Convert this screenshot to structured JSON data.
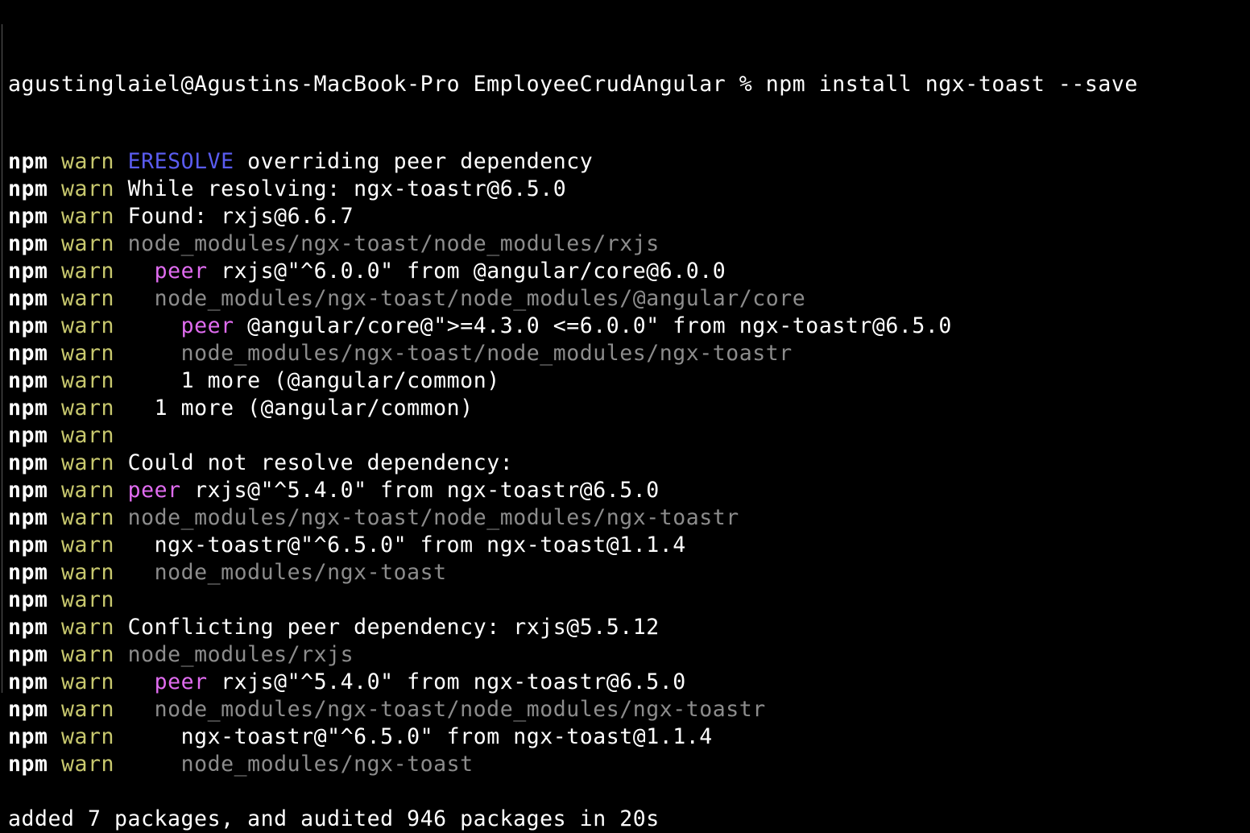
{
  "colors": {
    "background": "#000000",
    "npm": "#ffffff",
    "warn": "#c8c86e",
    "text": "#ffffff",
    "path": "#8c8c8c",
    "peer": "#e06cf0",
    "eresolve": "#5a5cf0"
  },
  "prompt": "agustinglaiel@Agustins-MacBook-Pro EmployeeCrudAngular % npm install ngx-toast --save",
  "npm_label": "npm",
  "warn_label": "warn",
  "lines": [
    {
      "indent": "",
      "tag": "ERESOLVE",
      "tag_style": "eresolve",
      "text": " overriding peer dependency",
      "style": "text"
    },
    {
      "indent": "",
      "tag": "",
      "tag_style": "",
      "text": "While resolving: ngx-toastr@6.5.0",
      "style": "text"
    },
    {
      "indent": "",
      "tag": "",
      "tag_style": "",
      "text": "Found: rxjs@6.6.7",
      "style": "text"
    },
    {
      "indent": "",
      "tag": "",
      "tag_style": "",
      "text": "node_modules/ngx-toast/node_modules/rxjs",
      "style": "dim"
    },
    {
      "indent": "  ",
      "tag": "peer",
      "tag_style": "peer",
      "text": " rxjs@\"^6.0.0\" from @angular/core@6.0.0",
      "style": "text"
    },
    {
      "indent": "  ",
      "tag": "",
      "tag_style": "",
      "text": "node_modules/ngx-toast/node_modules/@angular/core",
      "style": "dim"
    },
    {
      "indent": "    ",
      "tag": "peer",
      "tag_style": "peer",
      "text": " @angular/core@\">=4.3.0 <=6.0.0\" from ngx-toastr@6.5.0",
      "style": "text"
    },
    {
      "indent": "    ",
      "tag": "",
      "tag_style": "",
      "text": "node_modules/ngx-toast/node_modules/ngx-toastr",
      "style": "dim"
    },
    {
      "indent": "    ",
      "tag": "",
      "tag_style": "",
      "text": "1 more (@angular/common)",
      "style": "text"
    },
    {
      "indent": "  ",
      "tag": "",
      "tag_style": "",
      "text": "1 more (@angular/common)",
      "style": "text"
    },
    {
      "indent": "",
      "tag": "",
      "tag_style": "",
      "text": "",
      "style": "text"
    },
    {
      "indent": "",
      "tag": "",
      "tag_style": "",
      "text": "Could not resolve dependency:",
      "style": "text"
    },
    {
      "indent": "",
      "tag": "peer",
      "tag_style": "peer",
      "text": " rxjs@\"^5.4.0\" from ngx-toastr@6.5.0",
      "style": "text"
    },
    {
      "indent": "",
      "tag": "",
      "tag_style": "",
      "text": "node_modules/ngx-toast/node_modules/ngx-toastr",
      "style": "dim"
    },
    {
      "indent": "  ",
      "tag": "",
      "tag_style": "",
      "text": "ngx-toastr@\"^6.5.0\" from ngx-toast@1.1.4",
      "style": "text"
    },
    {
      "indent": "  ",
      "tag": "",
      "tag_style": "",
      "text": "node_modules/ngx-toast",
      "style": "dim"
    },
    {
      "indent": "",
      "tag": "",
      "tag_style": "",
      "text": "",
      "style": "text"
    },
    {
      "indent": "",
      "tag": "",
      "tag_style": "",
      "text": "Conflicting peer dependency: rxjs@5.5.12",
      "style": "text"
    },
    {
      "indent": "",
      "tag": "",
      "tag_style": "",
      "text": "node_modules/rxjs",
      "style": "dim"
    },
    {
      "indent": "  ",
      "tag": "peer",
      "tag_style": "peer",
      "text": " rxjs@\"^5.4.0\" from ngx-toastr@6.5.0",
      "style": "text"
    },
    {
      "indent": "  ",
      "tag": "",
      "tag_style": "",
      "text": "node_modules/ngx-toast/node_modules/ngx-toastr",
      "style": "dim"
    },
    {
      "indent": "    ",
      "tag": "",
      "tag_style": "",
      "text": "ngx-toastr@\"^6.5.0\" from ngx-toast@1.1.4",
      "style": "text"
    },
    {
      "indent": "    ",
      "tag": "",
      "tag_style": "",
      "text": "node_modules/ngx-toast",
      "style": "dim"
    }
  ],
  "summary": "added 7 packages, and audited 946 packages in 20s"
}
